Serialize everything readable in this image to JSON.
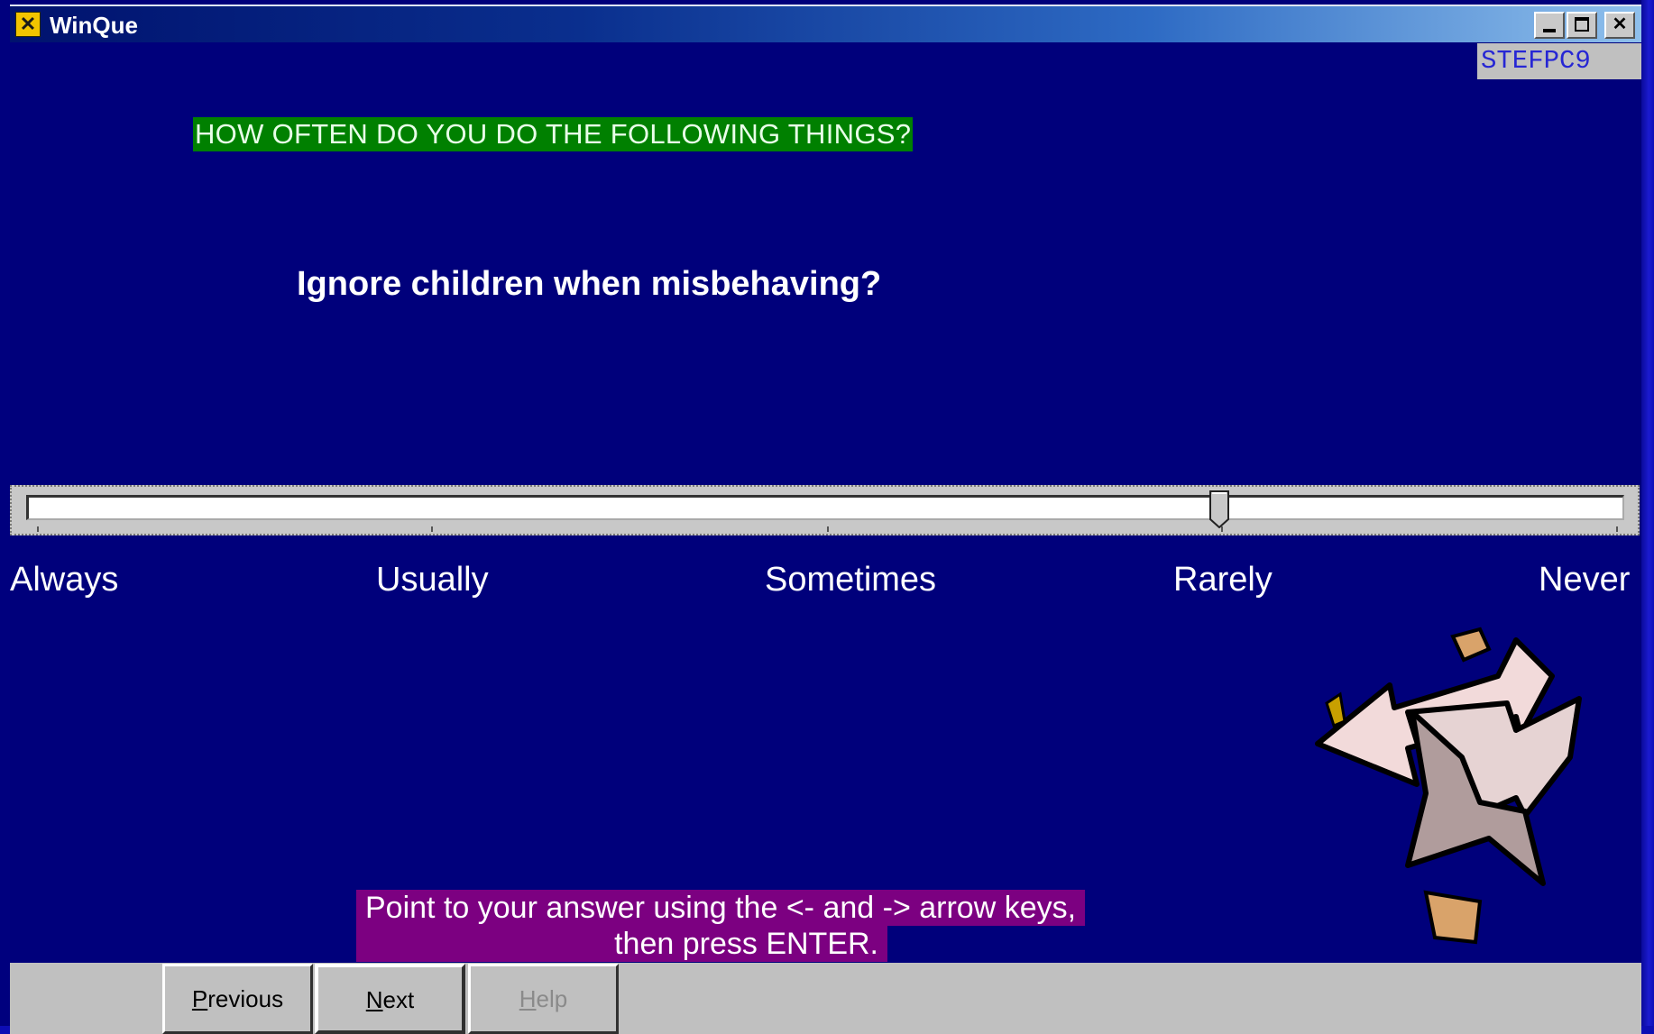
{
  "window": {
    "title": "WinQue",
    "controls": {
      "minimize": "_",
      "maximize": "□",
      "close": "✕"
    }
  },
  "computer_name": "STEFPC9",
  "heading": "HOW OFTEN DO YOU DO THE FOLLOWING THINGS?",
  "question": "Ignore children when misbehaving?",
  "scale": {
    "labels": [
      "Always",
      "Usually",
      "Sometimes",
      "Rarely",
      "Never"
    ],
    "selected_value": "Rarely",
    "selected_position_fraction": 0.75
  },
  "instructions": {
    "line1": "Point to your answer using the <- and -> arrow keys,",
    "line2": "then press ENTER."
  },
  "buttons": {
    "previous": {
      "accel": "P",
      "rest": "revious"
    },
    "next": {
      "accel": "N",
      "rest": "ext"
    },
    "help": {
      "accel": "H",
      "rest": "elp"
    }
  },
  "colors": {
    "background": "#00007e",
    "heading_bg": "#008000",
    "instruction_bg": "#7c0081",
    "panel": "#c0c0c0"
  }
}
